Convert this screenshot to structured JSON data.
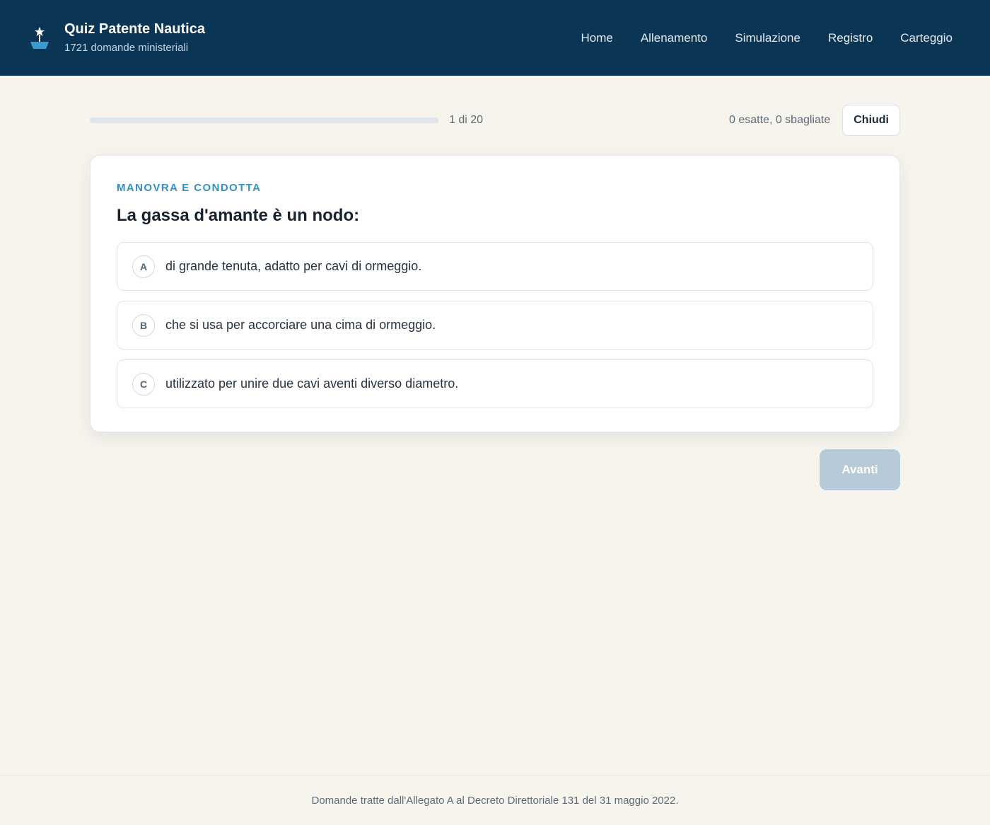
{
  "header": {
    "title": "Quiz Patente Nautica",
    "subtitle": "1721 domande ministeriali",
    "logo_icon": "boat-icon",
    "nav": [
      {
        "label": "Home"
      },
      {
        "label": "Allenamento"
      },
      {
        "label": "Simulazione"
      },
      {
        "label": "Registro"
      },
      {
        "label": "Carteggio"
      }
    ]
  },
  "progress": {
    "current": 1,
    "total": 20,
    "fraction": 0.0,
    "label": "1 di 20",
    "score_label": "0 esatte, 0 sbagliate",
    "close_label": "Chiudi"
  },
  "question": {
    "category": "MANOVRA E CONDOTTA",
    "text": "La gassa d'amante è un nodo:",
    "options": [
      {
        "letter": "A",
        "text": "di grande tenuta, adatto per cavi di ormeggio."
      },
      {
        "letter": "B",
        "text": "che si usa per accorciare una cima di ormeggio."
      },
      {
        "letter": "C",
        "text": "utilizzato per unire due cavi aventi diverso diametro."
      }
    ]
  },
  "actions": {
    "next_label": "Avanti"
  },
  "footer": {
    "text": "Domande tratte dall'Allegato A al Decreto Direttoriale 131 del 31 maggio 2022."
  },
  "colors": {
    "header_bg": "#0b3554",
    "accent": "#3390c0",
    "page_bg": "#f7f4ee",
    "next_disabled": "#b6cad8"
  }
}
